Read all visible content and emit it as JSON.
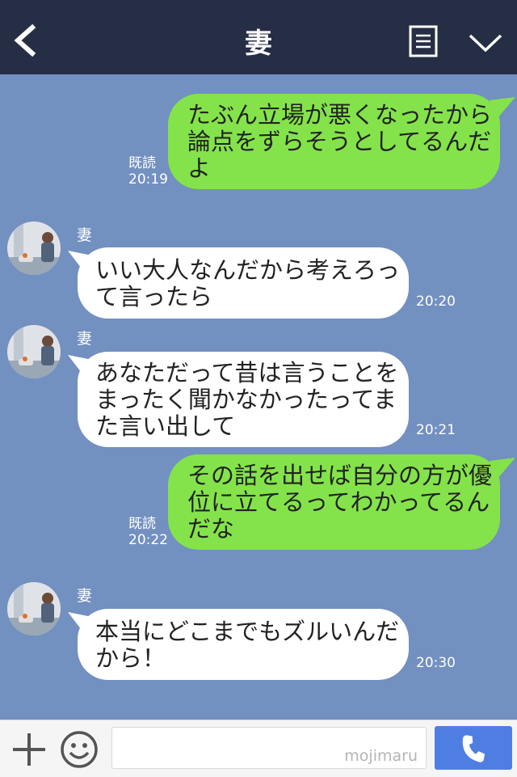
{
  "header": {
    "title": "妻",
    "back_icon": "chevron-left-icon",
    "menu_icon": "note-icon",
    "expand_icon": "chevron-down-icon"
  },
  "messages": [
    {
      "side": "out",
      "text": "たぶん立場が悪くなったから論点をずらそうとしてるんだよ",
      "read": "既読",
      "time": "20:19"
    },
    {
      "side": "in",
      "sender": "妻",
      "text": "いい大人なんだから考えろって言ったら",
      "time": "20:20"
    },
    {
      "side": "in",
      "sender": "妻",
      "text": "あなただって昔は言うことをまったく聞かなかったってまた言い出して",
      "time": "20:21"
    },
    {
      "side": "out",
      "text": "その話を出せば自分の方が優位に立てるってわかってるんだな",
      "read": "既読",
      "time": "20:22"
    },
    {
      "side": "in",
      "sender": "妻",
      "text": "本当にどこまでもズルいんだから！",
      "time": "20:30"
    }
  ],
  "footer": {
    "watermark": "mojimaru",
    "plus_icon": "plus-icon",
    "emoji_icon": "smiley-icon",
    "call_icon": "phone-icon"
  },
  "colors": {
    "header_bg": "#262e45",
    "chat_bg": "#7290c0",
    "out_bubble": "#84e34a",
    "in_bubble": "#ffffff",
    "call_button": "#4f7ee3"
  }
}
